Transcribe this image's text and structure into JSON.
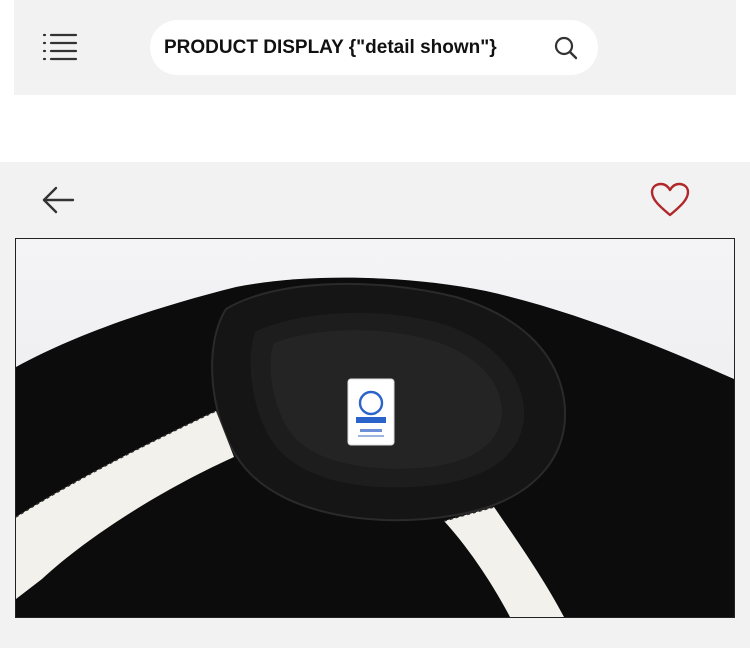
{
  "header": {
    "search_text": "PRODUCT DISPLAY {\"detail shown\"}",
    "menu_icon": "hamburger-menu-icon",
    "search_icon": "search-icon"
  },
  "detail": {
    "back_icon": "arrow-left-icon",
    "favorite_icon": "heart-outline-icon",
    "favorite_color": "#b0282c",
    "image_alt": "black sweatshirt collar close-up with white raglan stripes"
  },
  "colors": {
    "bar_bg": "#f2f2f2",
    "garment": "#0c0c0c",
    "stripe": "#f3f1ec"
  }
}
